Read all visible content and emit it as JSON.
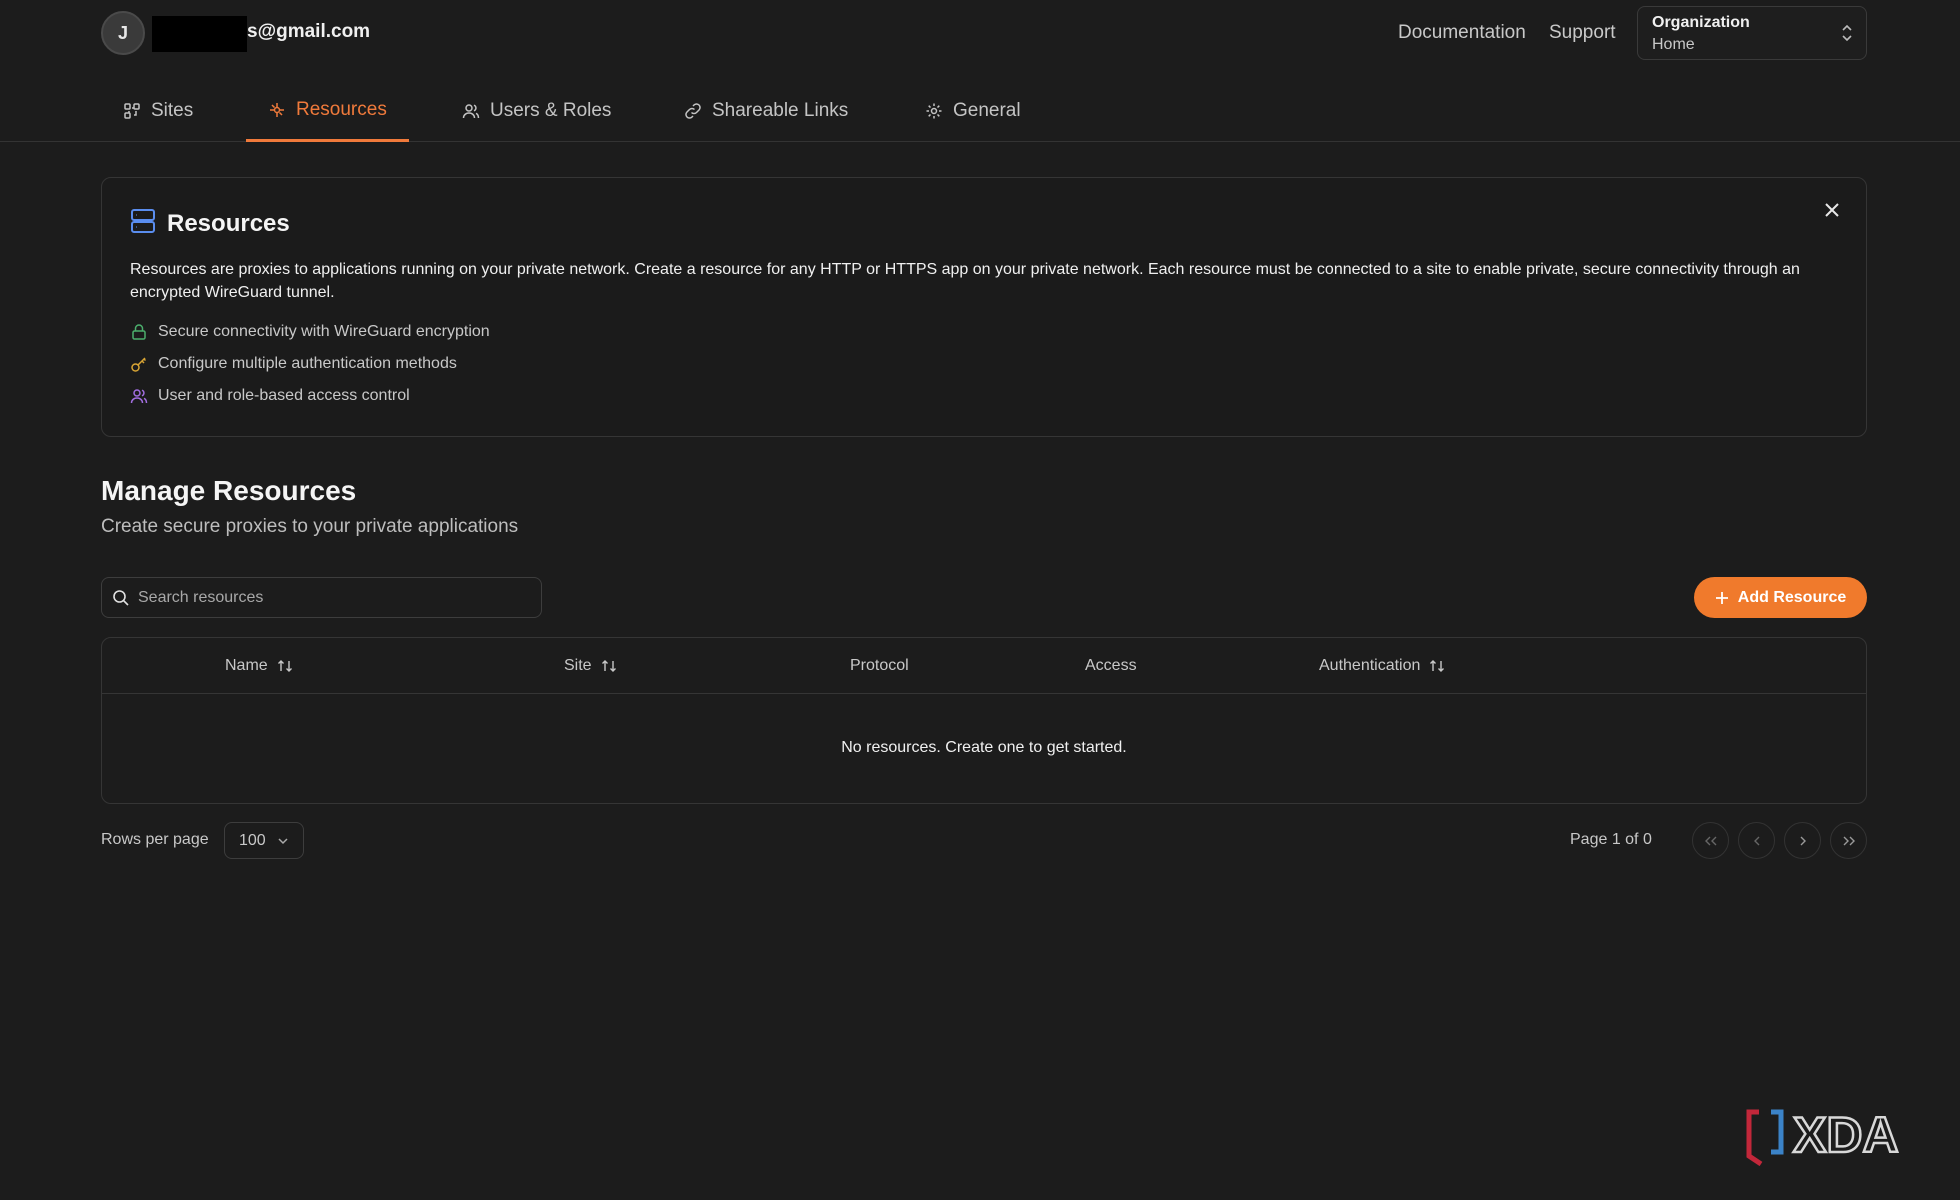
{
  "header": {
    "avatar_initial": "J",
    "email": "s@gmail.com",
    "links": {
      "documentation": "Documentation",
      "support": "Support"
    },
    "org": {
      "label": "Organization",
      "value": "Home"
    }
  },
  "tabs": [
    {
      "label": "Sites",
      "icon": "sites-icon"
    },
    {
      "label": "Resources",
      "icon": "resources-icon",
      "active": true
    },
    {
      "label": "Users & Roles",
      "icon": "users-icon"
    },
    {
      "label": "Shareable Links",
      "icon": "link-icon"
    },
    {
      "label": "General",
      "icon": "gear-icon"
    }
  ],
  "info": {
    "title": "Resources",
    "description": "Resources are proxies to applications running on your private network. Create a resource for any HTTP or HTTPS app on your private network. Each resource must be connected to a site to enable private, secure connectivity through an encrypted WireGuard tunnel.",
    "features": [
      {
        "text": "Secure connectivity with WireGuard encryption",
        "icon": "lock-icon"
      },
      {
        "text": "Configure multiple authentication methods",
        "icon": "key-icon"
      },
      {
        "text": "User and role-based access control",
        "icon": "users-icon"
      }
    ]
  },
  "manage": {
    "title": "Manage Resources",
    "subtitle": "Create secure proxies to your private applications",
    "search_placeholder": "Search resources",
    "add_button": "Add Resource"
  },
  "table": {
    "columns": [
      "Name",
      "Site",
      "Protocol",
      "Access",
      "Authentication"
    ],
    "empty_message": "No resources. Create one to get started."
  },
  "pagination": {
    "rows_label": "Rows per page",
    "rows_value": "100",
    "page_text": "Page 1 of 0"
  },
  "watermark": "XDA",
  "colors": {
    "accent": "#f07a2c",
    "background": "#1c1c1c"
  }
}
